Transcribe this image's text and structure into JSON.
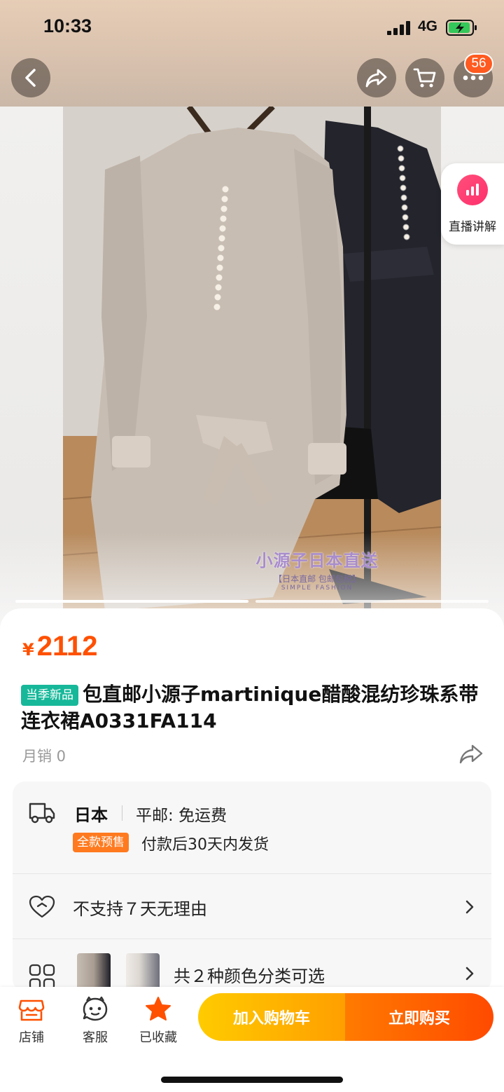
{
  "status_bar": {
    "time": "10:33",
    "network": "4G"
  },
  "nav": {
    "cart_badge": "56"
  },
  "live": {
    "label": "直播讲解"
  },
  "watermark": {
    "main": "小源子日本直送",
    "sub": "【日本直邮 包邮包税】",
    "sub2": "SIMPLE FASHION"
  },
  "product": {
    "price_symbol": "¥",
    "price": "2112",
    "tag": "当季新品",
    "title": "包直邮小源子martinique醋酸混纺珍珠系带连衣裙A0331FA114",
    "sales": "月销 0"
  },
  "shipping": {
    "origin": "日本",
    "method": "平邮: 免运费",
    "presale_tag": "全款预售",
    "ship_time": "付款后30天内发货"
  },
  "service": {
    "return_policy": "不支持７天无理由"
  },
  "sku": {
    "label": "共２种颜色分类可选"
  },
  "bottom_bar": {
    "store": "店铺",
    "service": "客服",
    "favorite": "已收藏",
    "add_to_cart": "加入购物车",
    "buy_now": "立即购买"
  },
  "colors": {
    "accent": "#ff5000",
    "tag_new": "#17b89a",
    "presale": "#ff7a1f",
    "cart_btn": "#ffb300",
    "buy_btn": "#ff5a00"
  }
}
